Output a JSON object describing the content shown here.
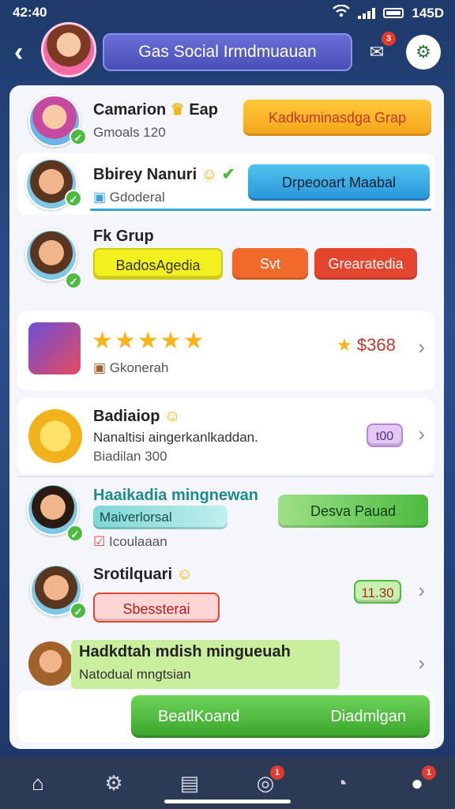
{
  "status": {
    "time": "42:40",
    "battery_label": "145D"
  },
  "header": {
    "title": "Gas Social Irmdmuauan",
    "notification_count": "3"
  },
  "cards": {
    "c1": {
      "name": "Camarion",
      "name_suffix": "Eap",
      "sub": "Gmoals 120",
      "button": "Kadkuminasdga Grap"
    },
    "c2": {
      "name": "Bbirey Nanuri",
      "sub": "Gdoderal",
      "button": "Drpeooart Maabal"
    },
    "c3": {
      "name": "Fk Grup",
      "pill1": "BadosAgedia",
      "pill2": "Svt",
      "pill3": "Grearatedia"
    },
    "c4": {
      "rating_stars": 5,
      "sub": "Gkonerah",
      "price": "$368"
    },
    "c5": {
      "name": "Badiaiop",
      "line": "Nanaltisi aingerkanlkaddan.",
      "sub": "Biadilan 300",
      "tag": "t00"
    },
    "c6": {
      "name": "Haaikadia mingnewan",
      "pill": "Maiverlorsal",
      "button": "Desva Pauad",
      "sub": "Icoulaaan"
    },
    "c7": {
      "name": "Srotilquari",
      "pill": "Sbessterai",
      "time": "11.30"
    },
    "c8": {
      "name": "Hadkdtah mdish mingueuah",
      "sub": "Natodual mngtsian"
    }
  },
  "actions": {
    "left": "BeatlKoand",
    "right": "Diadmlgan"
  },
  "nav": {
    "items": [
      "home-icon",
      "settings-icon",
      "document-icon",
      "compass-icon",
      "clock-icon",
      "chat-icon"
    ],
    "badge1": "1",
    "badge2": "1"
  },
  "colors": {
    "accent": "#5a5fd0",
    "green": "#4cbb3f",
    "orange": "#f7a61b",
    "red": "#e4452f"
  }
}
